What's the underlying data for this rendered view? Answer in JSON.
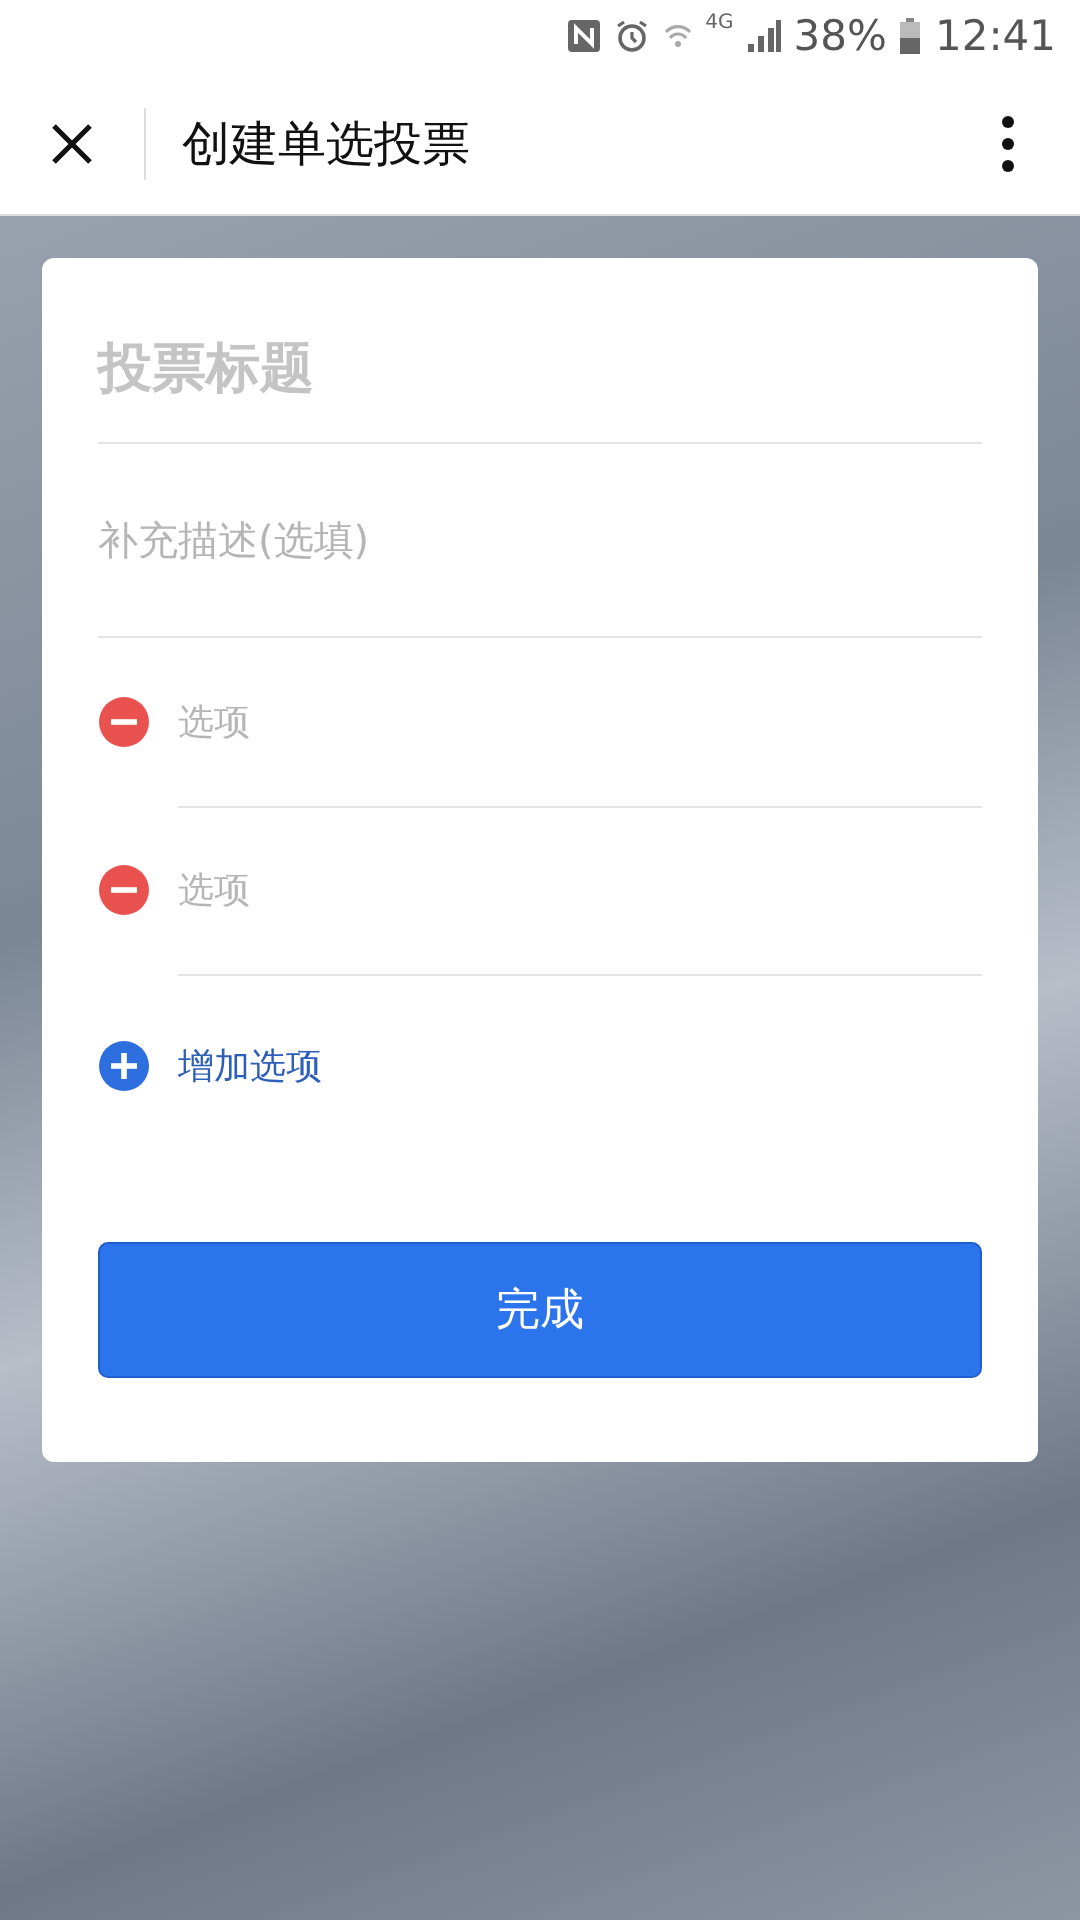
{
  "status_bar": {
    "network": "4G",
    "battery": "38%",
    "time": "12:41"
  },
  "header": {
    "title": "创建单选投票"
  },
  "form": {
    "title_placeholder": "投票标题",
    "description_placeholder": "补充描述(选填)",
    "options": [
      {
        "placeholder": "选项"
      },
      {
        "placeholder": "选项"
      }
    ],
    "add_option": "增加选项",
    "submit": "完成"
  }
}
